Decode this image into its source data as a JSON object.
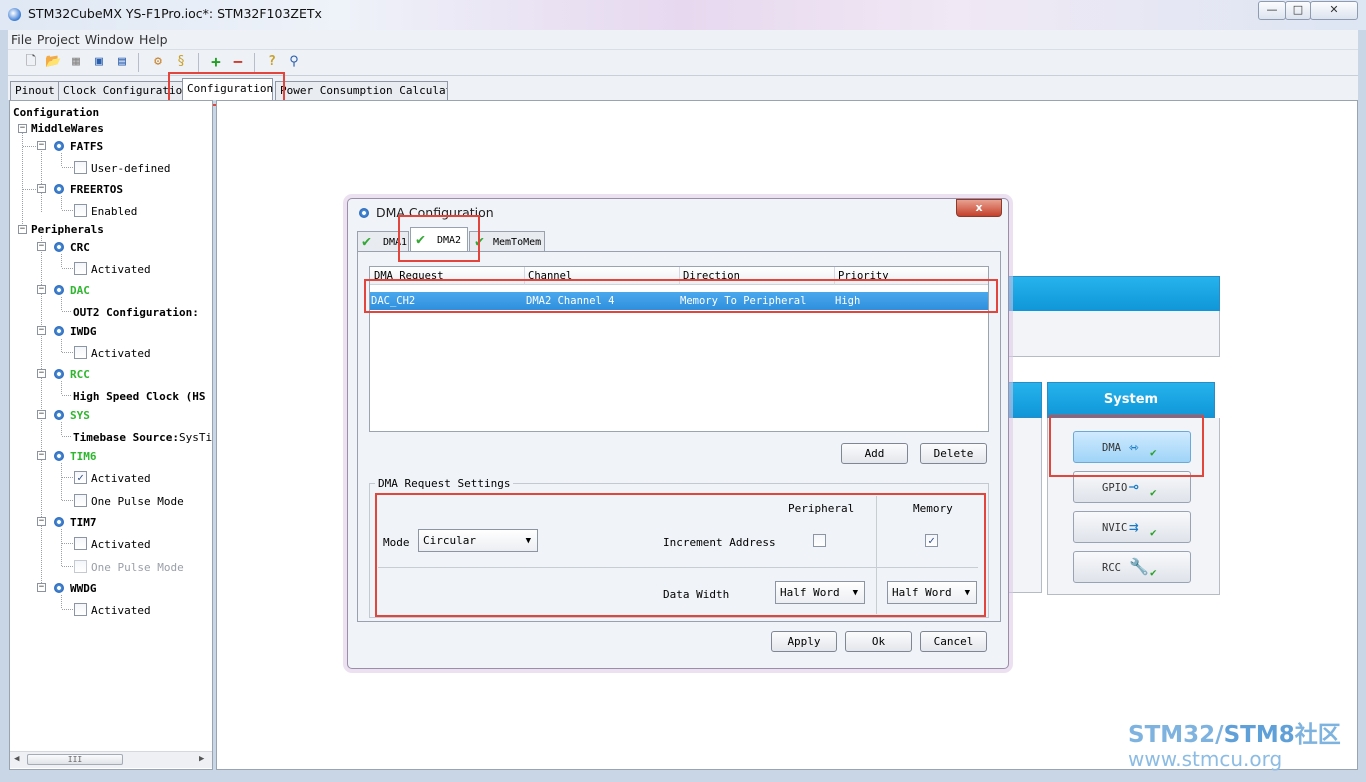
{
  "window": {
    "title": "STM32CubeMX YS-F1Pro.ioc*: STM32F103ZETx",
    "min": "—",
    "max": "□",
    "close": "✕"
  },
  "menu": [
    "File",
    "Project",
    "Window",
    "Help"
  ],
  "tabs": [
    "Pinout",
    "Clock Configuration",
    "Configuration",
    "Power Consumption Calculator"
  ],
  "tree": {
    "root": "Configuration",
    "middlewares": "MiddleWares",
    "fatfs": "FATFS",
    "fatfs_opt": "User-defined",
    "freertos": "FREERTOS",
    "freertos_opt": "Enabled",
    "peripherals": "Peripherals",
    "crc": "CRC",
    "crc_opt": "Activated",
    "dac": "DAC",
    "dac_opt": "OUT2 Configuration:",
    "iwdg": "IWDG",
    "iwdg_opt": "Activated",
    "rcc": "RCC",
    "rcc_opt_bold": "High Speed Clock (HS",
    "sys": "SYS",
    "sys_opt_bold": "Timebase Source:",
    "sys_opt_val": "SysTi",
    "tim6": "TIM6",
    "tim6_opt1": "Activated",
    "tim6_opt2": "One Pulse Mode",
    "tim7": "TIM7",
    "tim7_opt1": "Activated",
    "tim7_opt2": "One Pulse Mode",
    "wwdg": "WWDG",
    "wwdg_opt": "Activated",
    "scroll_thumb": "III"
  },
  "system": {
    "header": "System",
    "buttons": [
      "DMA",
      "GPIO",
      "NVIC",
      "RCC"
    ]
  },
  "dialog": {
    "title": "DMA Configuration",
    "close": "x",
    "tabs": [
      "DMA1",
      "DMA2",
      "MemToMem"
    ],
    "columns": [
      "DMA Request",
      "Channel",
      "Direction",
      "Priority"
    ],
    "rows": [
      {
        "request": "DAC_CH2",
        "channel": "DMA2 Channel 4",
        "direction": "Memory To Peripheral",
        "priority": "High"
      }
    ],
    "add": "Add",
    "delete": "Delete",
    "settings_title": "DMA Request Settings",
    "peripheral": "Peripheral",
    "memory": "Memory",
    "mode_label": "Mode",
    "mode_value": "Circular",
    "increment_label": "Increment Address",
    "data_width_label": "Data Width",
    "periph_width": "Half Word",
    "mem_width": "Half Word",
    "apply": "Apply",
    "ok": "Ok",
    "cancel": "Cancel"
  },
  "watermark": {
    "line1a": "STM32/",
    "line1b": "STM8",
    "line1c": "社区",
    "line2": "www.stmcu.org"
  }
}
